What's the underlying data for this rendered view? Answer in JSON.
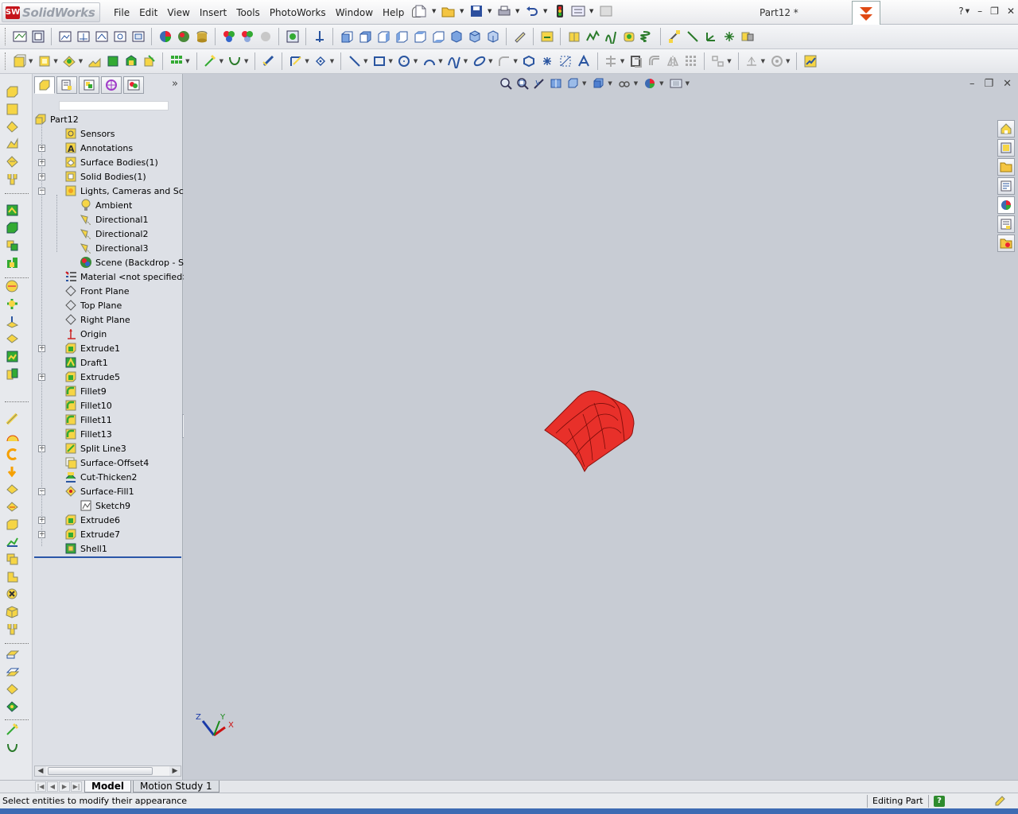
{
  "app": {
    "brand_label": "SolidWorks",
    "document_title": "Part12 *"
  },
  "menu": [
    "File",
    "Edit",
    "View",
    "Insert",
    "Tools",
    "PhotoWorks",
    "Window",
    "Help"
  ],
  "window_controls": {
    "help": "?",
    "minimize": "–",
    "restore": "❐",
    "close": "✕"
  },
  "feature_manager": {
    "tabs": [
      "FeatureManager design tree",
      "PropertyManager",
      "ConfigurationManager",
      "DimXpertManager",
      "Display Manager"
    ],
    "tree": [
      {
        "label": "Part12",
        "indent": 0,
        "expander": "",
        "icon": "part-icon"
      },
      {
        "label": "Sensors",
        "indent": 1,
        "expander": "",
        "icon": "sensors-icon"
      },
      {
        "label": "Annotations",
        "indent": 1,
        "expander": "+",
        "icon": "annotations-icon"
      },
      {
        "label": "Surface Bodies(1)",
        "indent": 1,
        "expander": "+",
        "icon": "surface-bodies-icon"
      },
      {
        "label": "Solid Bodies(1)",
        "indent": 1,
        "expander": "+",
        "icon": "solid-bodies-icon"
      },
      {
        "label": "Lights, Cameras and Scene",
        "indent": 1,
        "expander": "−",
        "icon": "lights-icon"
      },
      {
        "label": "Ambient",
        "indent": 2,
        "expander": "",
        "icon": "bulb-icon"
      },
      {
        "label": "Directional1",
        "indent": 2,
        "expander": "",
        "icon": "directional-light-icon"
      },
      {
        "label": "Directional2",
        "indent": 2,
        "expander": "",
        "icon": "directional-light-icon"
      },
      {
        "label": "Directional3",
        "indent": 2,
        "expander": "",
        "icon": "directional-light-icon"
      },
      {
        "label": "Scene (Backdrop - Studio R",
        "indent": 2,
        "expander": "",
        "icon": "scene-icon"
      },
      {
        "label": "Material <not specified>",
        "indent": 1,
        "expander": "",
        "icon": "material-icon"
      },
      {
        "label": "Front Plane",
        "indent": 1,
        "expander": "",
        "icon": "plane-icon"
      },
      {
        "label": "Top Plane",
        "indent": 1,
        "expander": "",
        "icon": "plane-icon"
      },
      {
        "label": "Right Plane",
        "indent": 1,
        "expander": "",
        "icon": "plane-icon"
      },
      {
        "label": "Origin",
        "indent": 1,
        "expander": "",
        "icon": "origin-icon"
      },
      {
        "label": "Extrude1",
        "indent": 1,
        "expander": "+",
        "icon": "extrude-icon"
      },
      {
        "label": "Draft1",
        "indent": 1,
        "expander": "",
        "icon": "draft-icon"
      },
      {
        "label": "Extrude5",
        "indent": 1,
        "expander": "+",
        "icon": "extrude-icon"
      },
      {
        "label": "Fillet9",
        "indent": 1,
        "expander": "",
        "icon": "fillet-icon"
      },
      {
        "label": "Fillet10",
        "indent": 1,
        "expander": "",
        "icon": "fillet-icon"
      },
      {
        "label": "Fillet11",
        "indent": 1,
        "expander": "",
        "icon": "fillet-icon"
      },
      {
        "label": "Fillet13",
        "indent": 1,
        "expander": "",
        "icon": "fillet-icon"
      },
      {
        "label": "Split Line3",
        "indent": 1,
        "expander": "+",
        "icon": "split-line-icon"
      },
      {
        "label": "Surface-Offset4",
        "indent": 1,
        "expander": "",
        "icon": "surface-offset-icon"
      },
      {
        "label": "Cut-Thicken2",
        "indent": 1,
        "expander": "",
        "icon": "cut-thicken-icon"
      },
      {
        "label": "Surface-Fill1",
        "indent": 1,
        "expander": "−",
        "icon": "surface-fill-icon"
      },
      {
        "label": "Sketch9",
        "indent": 2,
        "expander": "",
        "icon": "sketch-icon"
      },
      {
        "label": "Extrude6",
        "indent": 1,
        "expander": "+",
        "icon": "extrude-icon"
      },
      {
        "label": "Extrude7",
        "indent": 1,
        "expander": "+",
        "icon": "extrude-icon"
      },
      {
        "label": "Shell1",
        "indent": 1,
        "expander": "",
        "icon": "shell-icon"
      }
    ]
  },
  "bottom_tabs": [
    "Model",
    "Motion Study 1"
  ],
  "status": {
    "message": "Select entities to modify their appearance",
    "mode": "Editing Part",
    "help_glyph": "?"
  },
  "triad": {
    "z": "Z",
    "x": "X",
    "y": "Y"
  },
  "colors": {
    "model_red": "#e8302a",
    "viewport_bg": "#c8ccd4",
    "accent_blue": "#3d6bb3"
  }
}
